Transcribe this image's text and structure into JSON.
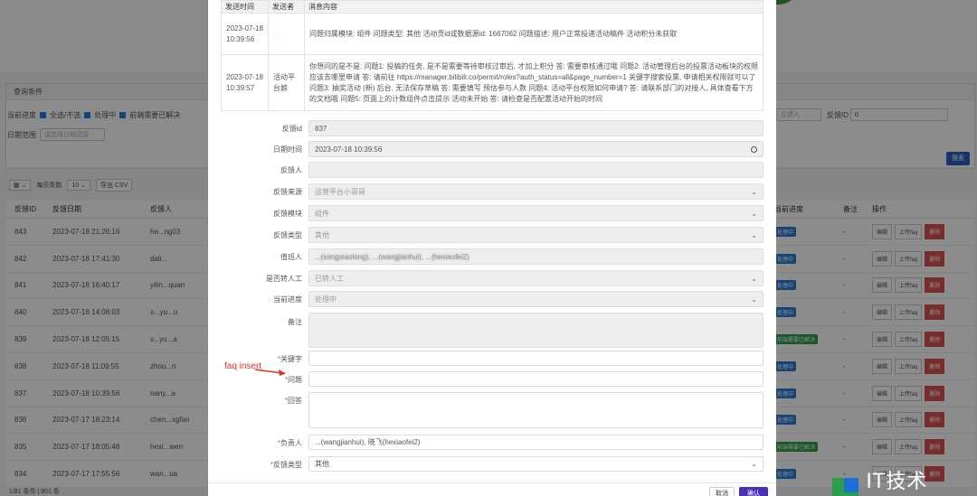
{
  "background": {
    "query_title": "查询条件",
    "filter_label": "当前进度",
    "filters": [
      "全选/不选",
      "处理中",
      "前端需要已解决"
    ],
    "date_label": "日期范围",
    "date_placeholder": "请选择日期范围",
    "feedback_placeholder": "反馈人",
    "feedback_id_label": "反馈ID",
    "feedback_id_value": "0",
    "search_label": "搜索",
    "page_size_label": "每页条数",
    "page_size": "10",
    "export_label": "导出 CSV",
    "table_headers": [
      "反馈ID",
      "反馈日期",
      "反馈人",
      "当前进度",
      "备注",
      "操作"
    ],
    "rows": [
      {
        "id": "843",
        "date": "2023-07-18 21:26:16",
        "user": "he...ng03",
        "status": "处理中",
        "note": "-"
      },
      {
        "id": "842",
        "date": "2023-07-18 17:41:30",
        "user": "dali...",
        "status": "处理中",
        "note": "-"
      },
      {
        "id": "841",
        "date": "2023-07-18 16:40:17",
        "user": "yilin...quan",
        "status": "处理中",
        "note": "-"
      },
      {
        "id": "840",
        "date": "2023-07-18 14:08:03",
        "user": "x...yu...u",
        "status": "处理中",
        "note": "-"
      },
      {
        "id": "839",
        "date": "2023-07-18 12:05:15",
        "user": "v...yu...a",
        "status": "前端需要已解决",
        "note": "-"
      },
      {
        "id": "838",
        "date": "2023-07-18 11:09:55",
        "user": "zhou...n",
        "status": "处理中",
        "note": "-"
      },
      {
        "id": "837",
        "date": "2023-07-18 10:39:56",
        "user": "nany...a",
        "status": "处理中",
        "note": "-"
      },
      {
        "id": "836",
        "date": "2023-07-17 18:23:14",
        "user": "chen...xgfan",
        "status": "处理中",
        "note": "-"
      },
      {
        "id": "835",
        "date": "2023-07-17 18:05:48",
        "user": "hexi...wen",
        "status": "前端需要已解决",
        "note": "-"
      },
      {
        "id": "834",
        "date": "2023-07-17 17:55:56",
        "user": "wan...ua",
        "status": "处理中",
        "note": "-"
      }
    ],
    "row_actions": [
      "编辑",
      "上传faq",
      "删除"
    ],
    "footer": "1/81 条件 | 801 条"
  },
  "modal": {
    "msg_headers": [
      "发送时间",
      "发送者",
      "消息内容"
    ],
    "messages": [
      {
        "time": "2023-07-18 10:39:56",
        "sender": "....",
        "content": "问题归属模块: 组件 问题类型: 其他 活动页id或数据源id: 1667062 问题描述: 用户正常投递活动稿件 活动积分未获取"
      },
      {
        "time": "2023-07-18 10:39:57",
        "sender": "活动平台娘",
        "content": "你想问的是不是: 问题1: 投稿的任务, 是不是需要等待审核过审后, 才加上积分 答: 需要审核通过哦 问题2: 活动管理后台的投票活动板块的权限应该去哪里申请 答: 请前往 https://manager.bilibili.co/permit/roles?auth_status=all&page_number=1 关键字搜索投票, 申请相关权限就可以了 问题3: 抽奖活动 (新) 后台, 无法保存草稿 答: 需要填写 预估参与人数 问题4: 活动平台权限如何申请? 答: 请联系部门的对接人, 具体查看下方的文档哦 问题5: 页面上的计数组件点击提示 活动未开始 答: 请检查是否配置活动开始的时间"
      }
    ],
    "fields": {
      "feedback_id": {
        "label": "反馈id",
        "value": "837"
      },
      "feedback_time": {
        "label": "日期时间",
        "value": "2023-07-18 10:39:56"
      },
      "feedback_user": {
        "label": "反馈人",
        "value": ""
      },
      "source": {
        "label": "反馈来源",
        "value": "运营平台小哥哥"
      },
      "module": {
        "label": "反馈模块",
        "value": "组件"
      },
      "type": {
        "label": "反馈类型",
        "value": "其他"
      },
      "duty": {
        "label": "值班人",
        "value": "...(songxiaolong), ...(wangjianhui), ...(hexiaofei2)"
      },
      "transfer": {
        "label": "是否转人工",
        "value": "已转人工"
      },
      "progress": {
        "label": "当前进度",
        "value": "处理中"
      },
      "remark": {
        "label": "备注",
        "value": ""
      },
      "keyword": {
        "label": "关键字",
        "value": ""
      },
      "question": {
        "label": "问题",
        "value": ""
      },
      "answer": {
        "label": "回答",
        "value": ""
      },
      "owner": {
        "label": "负责人",
        "value": "...(wangjianhui), 晓飞(hexiaofei2)"
      },
      "fb_type": {
        "label": "反馈类型",
        "value": "其他"
      }
    },
    "annotation": "faq insert",
    "cancel_label": "取消",
    "ok_label": "确认"
  },
  "watermark": "IT技术 6HU",
  "colors": {
    "accent": "#4a2fb6",
    "annotation": "#e0311f",
    "tag_blue": "#2b7fd1",
    "tag_green": "#2e9e4a",
    "danger": "#d9534f"
  }
}
